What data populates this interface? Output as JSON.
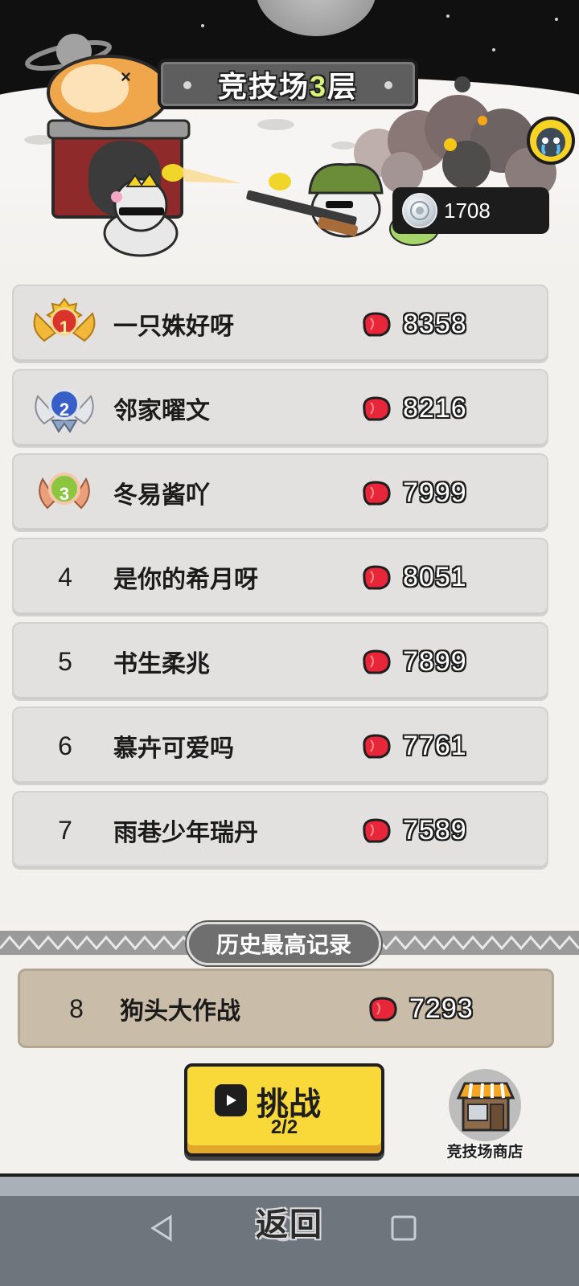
{
  "header": {
    "title_prefix": "竞技场",
    "title_floor": "3",
    "title_suffix": "层",
    "currency_icon": "silver-coin-icon",
    "currency_value": "1708"
  },
  "leaderboard": {
    "score_icon": "boxing-glove-icon",
    "rows": [
      {
        "rank": "1",
        "name": "一只姝好呀",
        "score": "8358",
        "medal": "gold"
      },
      {
        "rank": "2",
        "name": "邻家曜文",
        "score": "8216",
        "medal": "silver"
      },
      {
        "rank": "3",
        "name": "冬易酱吖",
        "score": "7999",
        "medal": "bronze"
      },
      {
        "rank": "4",
        "name": "是你的希月呀",
        "score": "8051"
      },
      {
        "rank": "5",
        "name": "书生柔兆",
        "score": "7899"
      },
      {
        "rank": "6",
        "name": "慕卉可爱吗",
        "score": "7761"
      },
      {
        "rank": "7",
        "name": "雨巷少年瑞丹",
        "score": "7589"
      }
    ]
  },
  "history": {
    "label": "历史最高记录",
    "rank": "8",
    "name": "狗头大作战",
    "score": "7293"
  },
  "actions": {
    "challenge_label": "挑战",
    "challenge_count": "2/2",
    "shop_label": "竞技场商店"
  },
  "nav": {
    "return_label": "返回"
  },
  "colors": {
    "sky": "#101010",
    "row_bg": "#e2e1e0",
    "history_row_bg": "#c9bda9",
    "challenge_yellow": "#f9d93a",
    "glove_red": "#e8263a",
    "floor_number": "#d7f27a"
  }
}
